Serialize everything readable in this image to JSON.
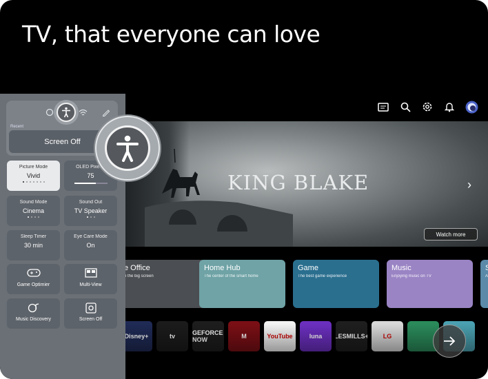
{
  "headline": "TV, that everyone can love",
  "topbar": {
    "icons": [
      "guide-icon",
      "search-icon",
      "settings-icon",
      "notification-icon",
      "profile-avatar"
    ]
  },
  "hero": {
    "title": "KING BLAKE",
    "watch_label": "Watch more"
  },
  "categories": [
    {
      "title": "e Office",
      "subtitle": "n the big screen",
      "color": "#4b4e52"
    },
    {
      "title": "Home Hub",
      "subtitle": "The center of the smart home",
      "color": "#6fa3a6"
    },
    {
      "title": "Game",
      "subtitle": "The best game experience",
      "color": "#2b6f8f"
    },
    {
      "title": "Music",
      "subtitle": "Enjoying music on TV",
      "color": "#9a84c4"
    },
    {
      "title": "S",
      "subtitle": "A",
      "color": "#5a8aa8"
    }
  ],
  "apps": [
    {
      "label": "Disney+",
      "color": "#1f2a55"
    },
    {
      "label": "tv",
      "color": "#1b1b1b"
    },
    {
      "label": "GEFORCE NOW",
      "color": "#1d1d1d"
    },
    {
      "label": "M",
      "color": "#7a0f15"
    },
    {
      "label": "YouTube",
      "color": "#f2f2f2"
    },
    {
      "label": "luna",
      "color": "#6b2fbf"
    },
    {
      "label": "LESMILLS+",
      "color": "#1e1e1e"
    },
    {
      "label": "LG",
      "color": "#d8d8d8"
    },
    {
      "label": "",
      "color": "#2a8a5a"
    },
    {
      "label": "",
      "color": "#4aa0b0"
    }
  ],
  "panel": {
    "recent_label": "Recent",
    "screen_off_label": "Screen Off",
    "tiles": [
      {
        "label": "Picture Mode",
        "value": "Vivid"
      },
      {
        "label": "OLED Pixel B",
        "value": "75",
        "level": 0.65
      },
      {
        "label": "Sound Mode",
        "value": "Cinema"
      },
      {
        "label": "Sound Out",
        "value": "TV Speaker"
      },
      {
        "label": "Sleep Timer",
        "value": "30 min"
      },
      {
        "label": "Eye Care Mode",
        "value": "On"
      }
    ],
    "actions": [
      {
        "label": "Game Optimier",
        "icon": "gamepad-icon"
      },
      {
        "label": "Multi-View",
        "icon": "multiview-icon"
      },
      {
        "label": "Music Discovery",
        "icon": "music-discovery-icon"
      },
      {
        "label": "Screen Off",
        "icon": "screen-off-icon"
      }
    ]
  }
}
